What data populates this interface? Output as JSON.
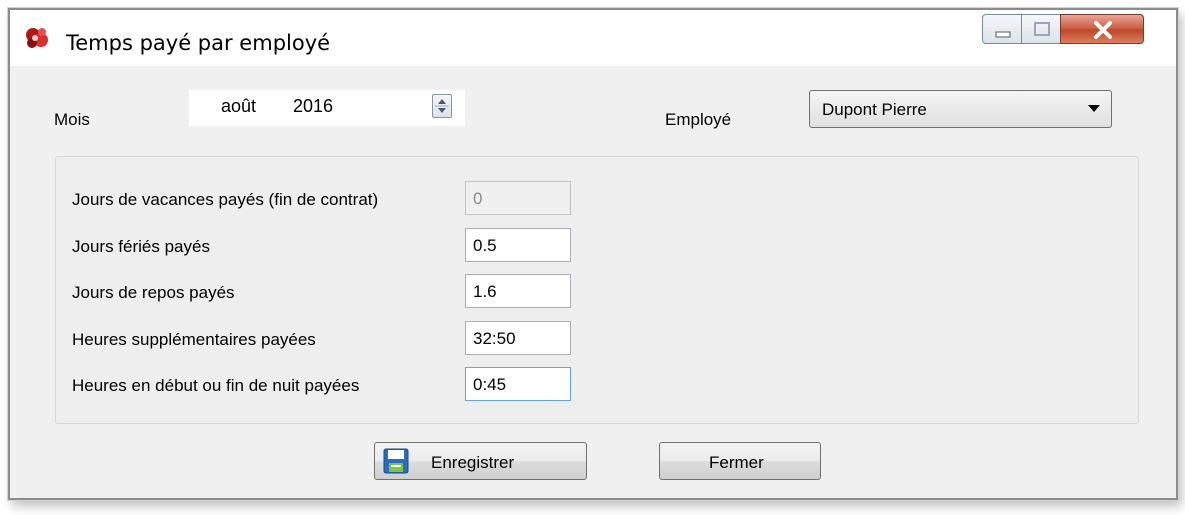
{
  "window": {
    "title": "Temps payé par employé",
    "app_icon": "red-puzzle-icon",
    "controls": {
      "minimize": "minimize-icon",
      "maximize": "maximize-icon",
      "close": "close-icon"
    }
  },
  "filters": {
    "month_label": "Mois",
    "month_value": "août",
    "year_value": "2016",
    "employee_label": "Employé",
    "employee_value": "Dupont Pierre"
  },
  "fields": [
    {
      "label": "Jours de vacances payés (fin de contrat)",
      "value": "0",
      "disabled": true
    },
    {
      "label": "Jours fériés payés",
      "value": "0.5"
    },
    {
      "label": "Jours de repos payés",
      "value": "1.6"
    },
    {
      "label": "Heures supplémentaires payées",
      "value": "32:50"
    },
    {
      "label": "Heures en début ou fin de nuit payées",
      "value": "0:45",
      "focused": true
    }
  ],
  "buttons": {
    "save_label": "Enregistrer",
    "save_icon": "floppy-disk-icon",
    "close_label": "Fermer"
  },
  "colors": {
    "window_bg": "#f0f0f0",
    "close_button": "#c0472c",
    "focus_border": "#6fa3d6"
  }
}
